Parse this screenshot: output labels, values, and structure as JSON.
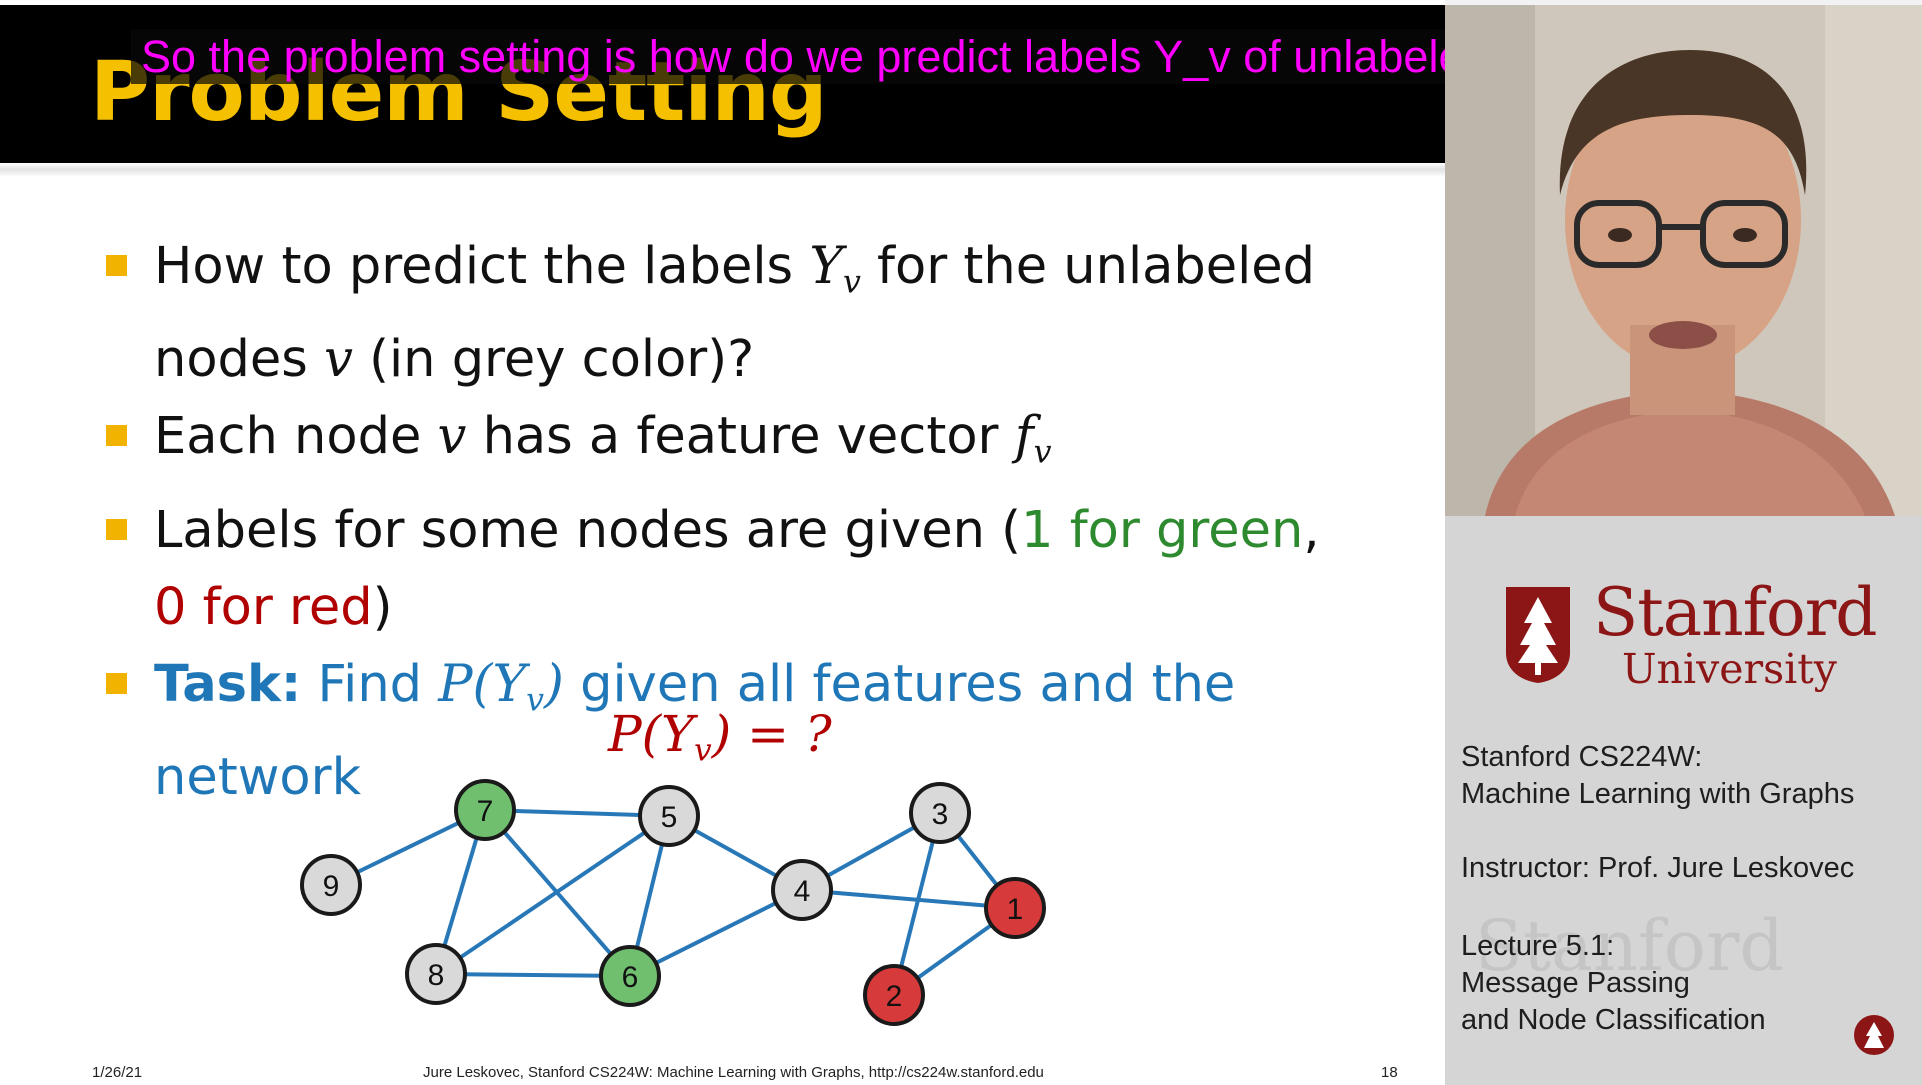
{
  "slide": {
    "title": "Problem Setting",
    "bullets": {
      "b1_text1": "How to predict the labels ",
      "b1_var": "Y",
      "b1_sub": "v",
      "b1_text2": " for the unlabeled",
      "b1_text3": "nodes ",
      "b1_var2": "v",
      "b1_text4": " (in grey color)?",
      "b2_text1": "Each node ",
      "b2_var": "v",
      "b2_text2": " has a feature vector ",
      "b2_var2": "f",
      "b2_sub": "v",
      "b3_text1": "Labels for some nodes are given (",
      "b3_green": "1 for green",
      "b3_comma": ",",
      "b3_red": "0 for red",
      "b3_close": ")",
      "b4_task": "Task:",
      "b4_text1": " Find ",
      "b4_p": "P(Y",
      "b4_sub": "v",
      "b4_close": ")",
      "b4_text2": " given all features and the",
      "b4_text3": "network"
    },
    "equation": {
      "p": "P(Y",
      "sub": "v",
      "rest": ") = ?"
    },
    "graph": {
      "colors": {
        "green": "#6fbf6f",
        "red": "#d63a3a",
        "grey": "#d9d9d9",
        "edge": "#2878b8"
      },
      "nodes": [
        {
          "id": "7",
          "label": "7",
          "color": "green"
        },
        {
          "id": "5",
          "label": "5",
          "color": "grey"
        },
        {
          "id": "3",
          "label": "3",
          "color": "grey"
        },
        {
          "id": "9",
          "label": "9",
          "color": "grey"
        },
        {
          "id": "4",
          "label": "4",
          "color": "grey"
        },
        {
          "id": "1",
          "label": "1",
          "color": "red"
        },
        {
          "id": "8",
          "label": "8",
          "color": "grey"
        },
        {
          "id": "6",
          "label": "6",
          "color": "green"
        },
        {
          "id": "2",
          "label": "2",
          "color": "red"
        }
      ],
      "edges": [
        [
          "9",
          "7"
        ],
        [
          "7",
          "5"
        ],
        [
          "7",
          "8"
        ],
        [
          "7",
          "6"
        ],
        [
          "5",
          "8"
        ],
        [
          "5",
          "6"
        ],
        [
          "5",
          "4"
        ],
        [
          "8",
          "6"
        ],
        [
          "6",
          "4"
        ],
        [
          "4",
          "3"
        ],
        [
          "4",
          "1"
        ],
        [
          "3",
          "1"
        ],
        [
          "3",
          "2"
        ],
        [
          "2",
          "1"
        ]
      ]
    },
    "footer": {
      "date": "1/26/21",
      "credit": "Jure Leskovec, Stanford CS224W: Machine Learning with Graphs, http://cs224w.stanford.edu",
      "page": "18"
    }
  },
  "caption": "So the problem setting is how do we predict labels Y_v of unlabeled node V?",
  "panel": {
    "logo_name": "Stanford",
    "logo_sub": "University",
    "course_line1": "Stanford CS224W:",
    "course_line2": "Machine Learning with Graphs",
    "instructor": "Instructor: Prof. Jure Leskovec",
    "lecture_line1": "Lecture 5.1:",
    "lecture_line2": "Message Passing",
    "lecture_line3": "and Node Classification",
    "watermark": "Stanford",
    "brand_color": "#8c1515"
  }
}
